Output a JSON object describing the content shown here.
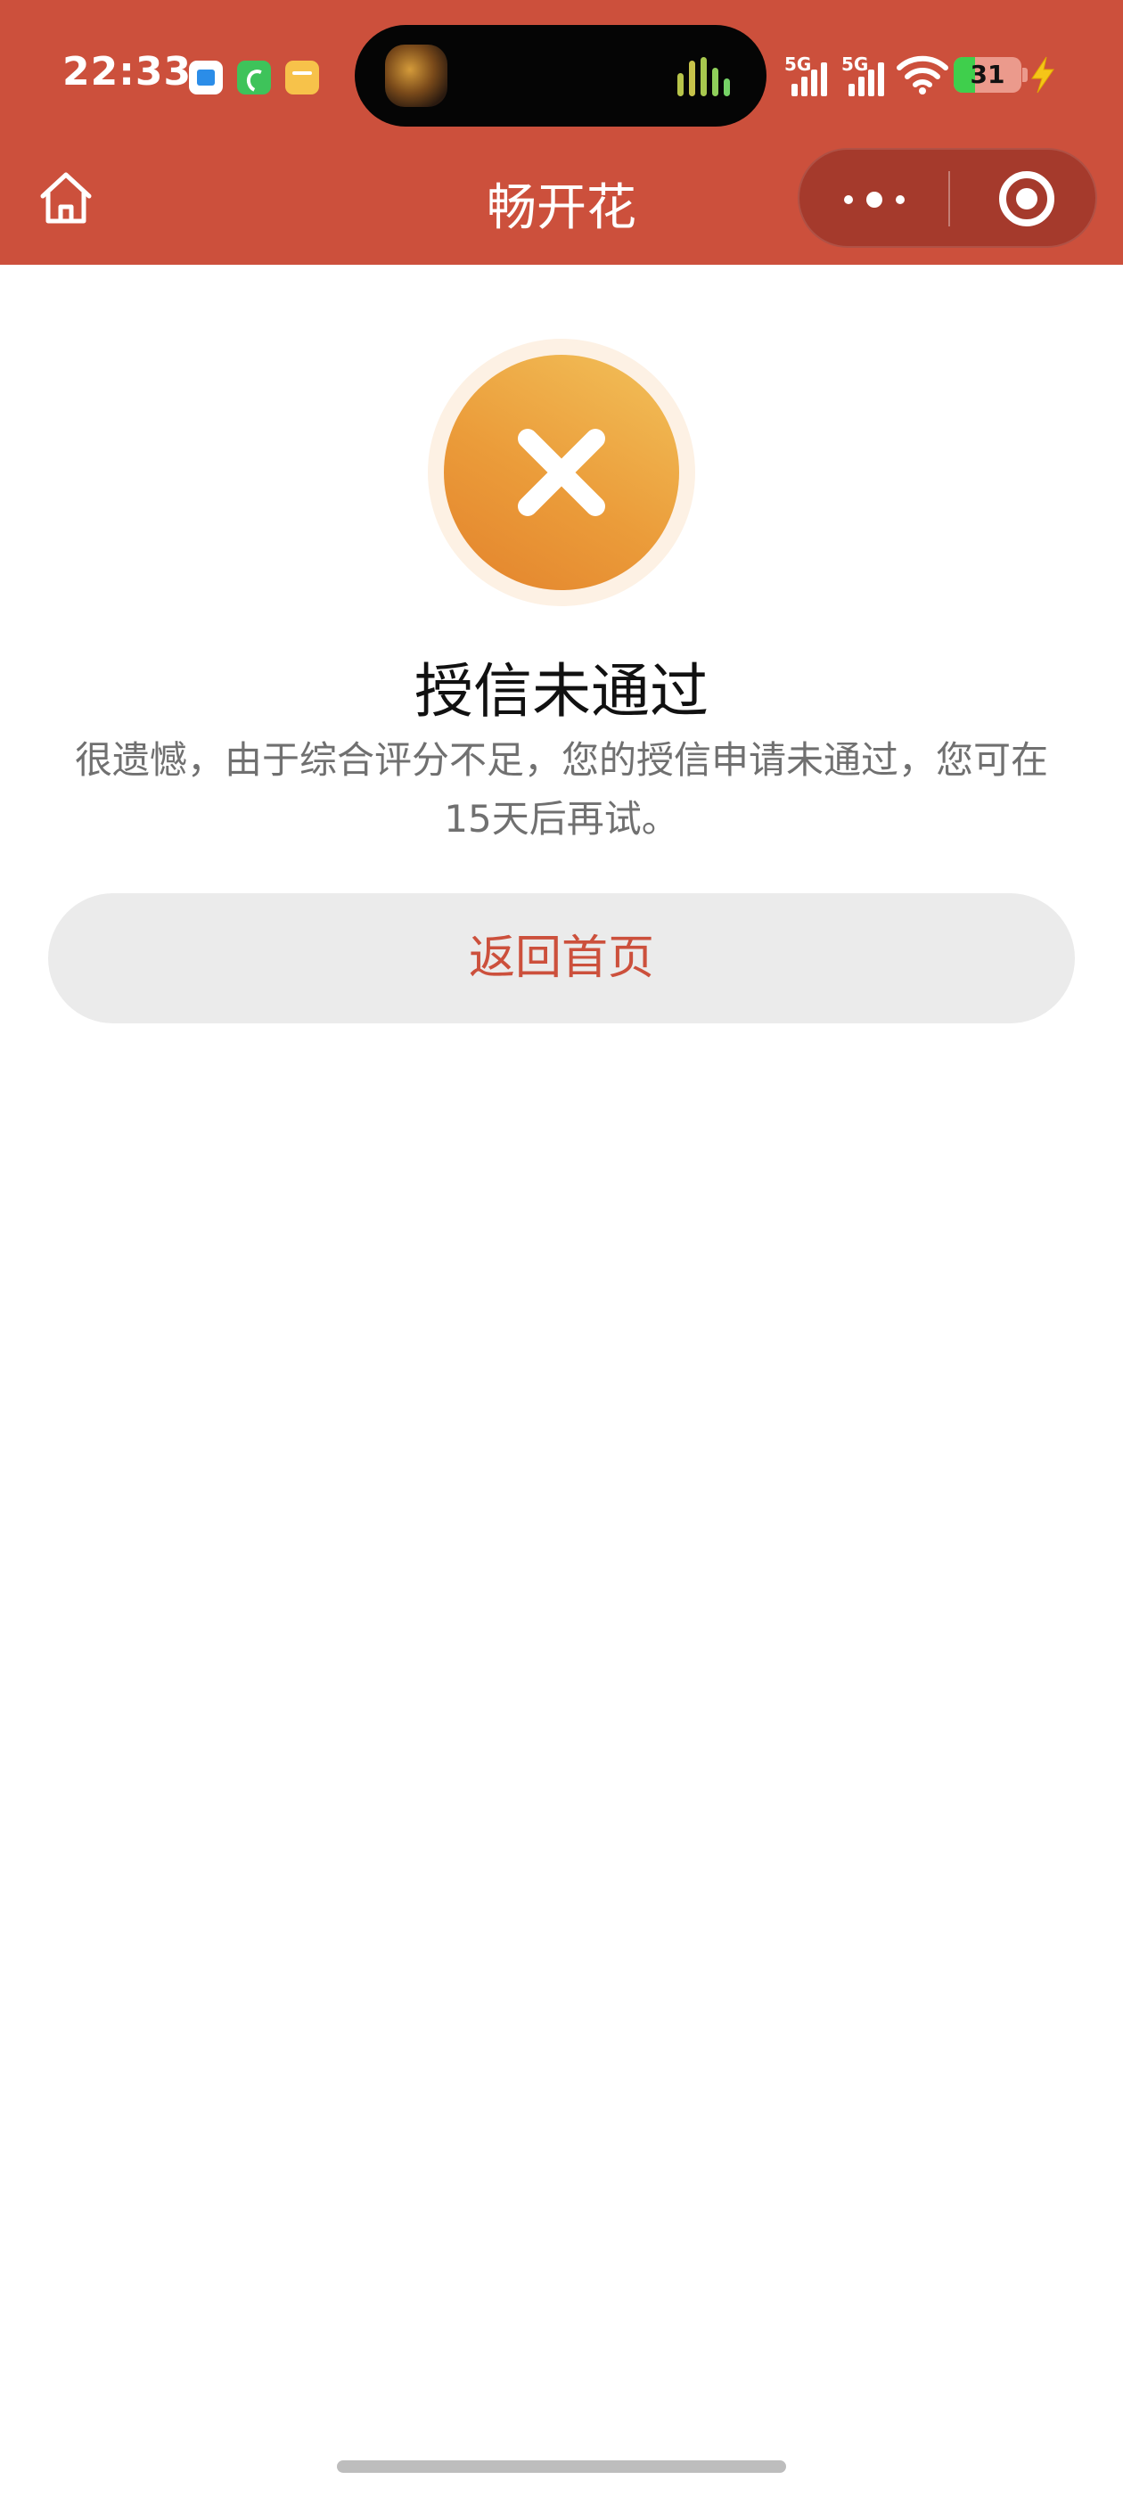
{
  "status_bar": {
    "time": "22:33",
    "notification_icons": [
      "app-notification-icon",
      "phone-app-icon",
      "notes-app-icon"
    ],
    "signal_1_label": "5G",
    "signal_2_label": "5G",
    "battery_level": "31",
    "battery_fraction": 0.31,
    "charging": true
  },
  "nav": {
    "title": "畅开花",
    "home_icon": "home-icon",
    "more_icon": "more-dots-icon",
    "close_icon": "mini-program-close-icon"
  },
  "result": {
    "status": "rejected",
    "icon": "close-x-icon",
    "title": "授信未通过",
    "description": "很遗憾，由于综合评分不足，您的授信申请未通过，您可在15天后再试。"
  },
  "actions": {
    "back_home_label": "返回首页"
  },
  "colors": {
    "brand": "#cc503c",
    "icon_gradient_top": "#f2c15a",
    "icon_gradient_bottom": "#e3832c",
    "button_bg": "#ebebeb"
  }
}
